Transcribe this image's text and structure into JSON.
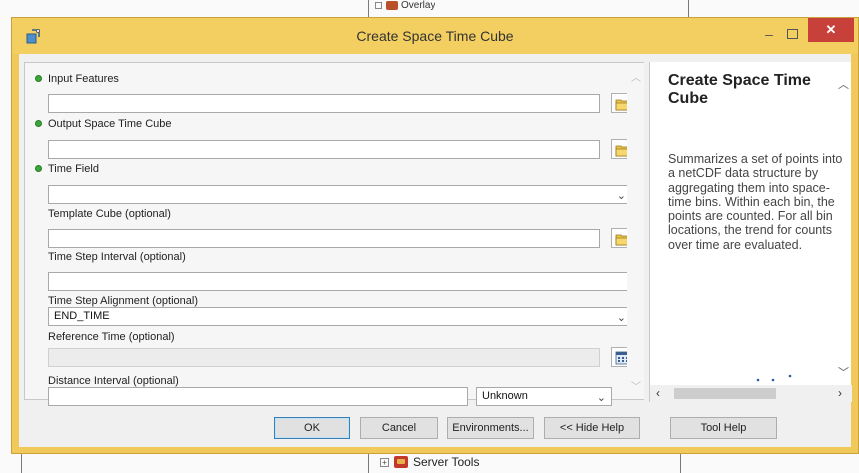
{
  "background": {
    "overlay_item": "Overlay",
    "server_tools_item": "Server Tools"
  },
  "window": {
    "title": "Create Space Time Cube",
    "minimize": "–",
    "close": "✕"
  },
  "parameters": {
    "input_features": {
      "label": "Input Features",
      "value": ""
    },
    "output_cube": {
      "label": "Output Space Time Cube",
      "value": ""
    },
    "time_field": {
      "label": "Time Field",
      "value": ""
    },
    "template_cube": {
      "label": "Template Cube (optional)",
      "value": ""
    },
    "time_step_interval": {
      "label": "Time Step Interval (optional)",
      "value": ""
    },
    "time_step_alignment": {
      "label": "Time Step Alignment (optional)",
      "value": "END_TIME"
    },
    "reference_time": {
      "label": "Reference Time (optional)",
      "value": ""
    },
    "distance_interval": {
      "label": "Distance Interval (optional)",
      "value": "",
      "unit": "Unknown"
    }
  },
  "help": {
    "title": "Create Space Time Cube",
    "body": "Summarizes a set of points into a netCDF data structure by aggregating them into space-time bins. Within each bin, the points are counted. For all bin locations, the trend for counts over time are evaluated."
  },
  "buttons": {
    "ok": "OK",
    "cancel": "Cancel",
    "environments": "Environments...",
    "hide_help": "<< Hide Help",
    "tool_help": "Tool Help"
  },
  "colors": {
    "titlebar": "#f3cf61",
    "close_button": "#c7403a",
    "required_dot": "#39a935"
  }
}
